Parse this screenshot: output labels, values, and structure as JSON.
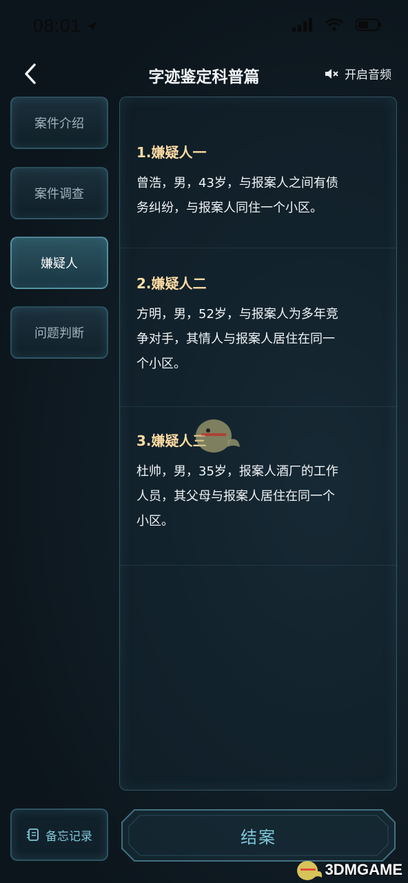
{
  "status_bar": {
    "time": "08:01"
  },
  "header": {
    "title": "字迹鉴定科普篇",
    "audio_label": "开启音频"
  },
  "sidebar": {
    "items": [
      {
        "label": "案件介绍",
        "active": false
      },
      {
        "label": "案件调查",
        "active": false
      },
      {
        "label": "嫌疑人",
        "active": true
      },
      {
        "label": "问题判断",
        "active": false
      }
    ]
  },
  "suspects": [
    {
      "title": "1.嫌疑人一",
      "lines": [
        "曾浩，男，43岁，与报案人之间有债",
        "务纠纷，与报案人同住一个小区。"
      ]
    },
    {
      "title": "2.嫌疑人二",
      "lines": [
        "方明，男，52岁，与报案人为多年竞",
        "争对手，其情人与报案人居住在同一",
        "个小区。"
      ]
    },
    {
      "title": "3.嫌疑人三",
      "lines": [
        "杜帅，男，35岁，报案人酒厂的工作",
        "人员，其父母与报案人居住在同一个",
        "小区。"
      ]
    }
  ],
  "footer": {
    "memo_label": "备忘记录",
    "close_case_label": "结案"
  },
  "watermark": {
    "text": "3DMGAME"
  },
  "colors": {
    "accent": "#7fc7d8",
    "title_gold": "#ffdca3",
    "bg": "#0e1820"
  }
}
